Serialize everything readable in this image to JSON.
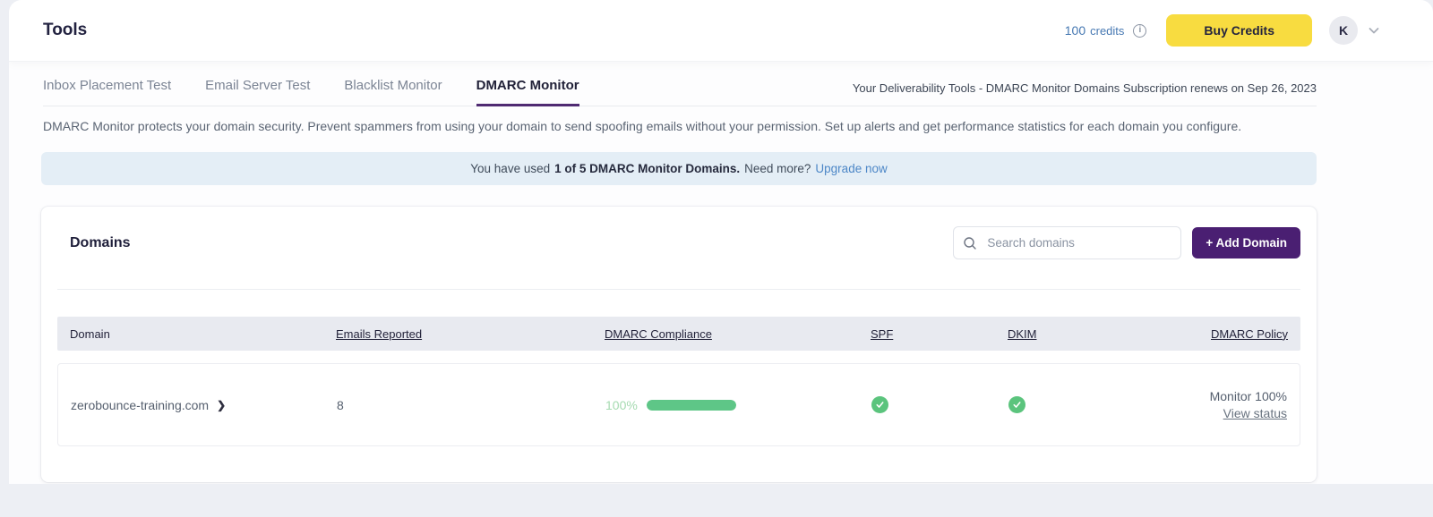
{
  "header": {
    "title": "Tools",
    "credits_amount": "100",
    "credits_label": "credits",
    "buy_credits_label": "Buy Credits",
    "avatar_initial": "K"
  },
  "tabs": {
    "items": [
      {
        "label": "Inbox Placement Test",
        "active": false
      },
      {
        "label": "Email Server Test",
        "active": false
      },
      {
        "label": "Blacklist Monitor",
        "active": false
      },
      {
        "label": "DMARC Monitor",
        "active": true
      }
    ],
    "subscription_note": "Your Deliverability Tools - DMARC Monitor Domains Subscription renews on Sep 26, 2023"
  },
  "description": "DMARC Monitor protects your domain security. Prevent spammers from using your domain to send spoofing emails without your permission. Set up alerts and get performance statistics for each domain you configure.",
  "usage_banner": {
    "prefix": "You have used",
    "bold": "1 of 5 DMARC Monitor Domains.",
    "middle": "Need more?",
    "link": "Upgrade now"
  },
  "domains_card": {
    "title": "Domains",
    "search_placeholder": "Search domains",
    "add_button_label": "+ Add Domain",
    "table": {
      "columns": [
        "Domain",
        "Emails Reported",
        "DMARC Compliance",
        "SPF",
        "DKIM",
        "DMARC Policy"
      ],
      "rows": [
        {
          "domain": "zerobounce-training.com",
          "emails_reported": "8",
          "compliance_pct_label": "100%",
          "compliance_value": 100,
          "spf_status": "pass",
          "dkim_status": "pass",
          "policy": "Monitor 100%",
          "policy_link": "View status"
        }
      ]
    }
  },
  "colors": {
    "buy_credits_bg": "#f8dc40",
    "add_domain_bg": "#4a1f72",
    "active_tab_underline": "#4f2a72",
    "banner_bg": "#e4eef6",
    "link_blue": "#4d87c7",
    "credits_blue": "#4678b2",
    "table_header_bg": "#e8eaf0",
    "success_green": "#5ec687",
    "compliance_text_green": "#a5dab0"
  }
}
